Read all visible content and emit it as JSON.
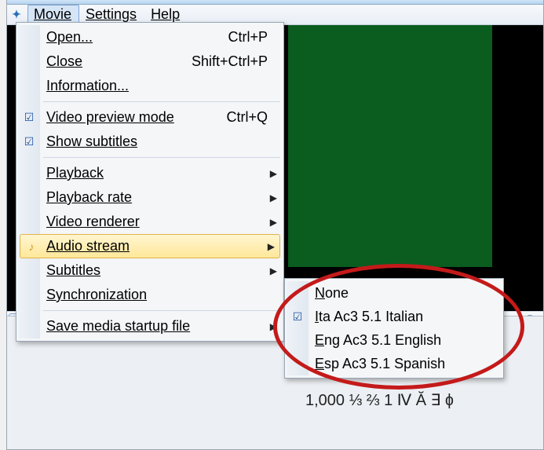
{
  "menubar": {
    "items": [
      {
        "label": "Movie",
        "active": true
      },
      {
        "label": "Settings",
        "active": false
      },
      {
        "label": "Help",
        "active": false
      }
    ]
  },
  "menu": {
    "open": {
      "label": "Open...",
      "accel": "Ctrl+P"
    },
    "close": {
      "label": "Close",
      "accel": "Shift+Ctrl+P"
    },
    "information": {
      "label": "Information..."
    },
    "video_preview": {
      "label": "Video preview mode",
      "accel": "Ctrl+Q",
      "checked": true
    },
    "show_subtitles": {
      "label": "Show subtitles",
      "checked": true
    },
    "playback": {
      "label": "Playback"
    },
    "playback_rate": {
      "label": "Playback rate"
    },
    "video_renderer": {
      "label": "Video renderer"
    },
    "audio_stream": {
      "label": "Audio stream"
    },
    "subtitles": {
      "label": "Subtitles"
    },
    "synchronization": {
      "label": "Synchronization"
    },
    "save_startup": {
      "label": "Save media startup file"
    }
  },
  "audio_submenu": {
    "items": [
      {
        "mnemonic": "N",
        "rest": "one",
        "checked": false
      },
      {
        "mnemonic": "I",
        "rest": "ta Ac3 5.1 Italian",
        "checked": true
      },
      {
        "mnemonic": "E",
        "rest": "ng Ac3 5.1 English",
        "checked": false
      },
      {
        "mnemonic": "E",
        "rest": "sp Ac3 5.1 Spanish",
        "checked": false
      }
    ]
  },
  "status_line": "1,000  ⅓ ⅔ 1 Ⅳ Ă ∃ ɸ"
}
